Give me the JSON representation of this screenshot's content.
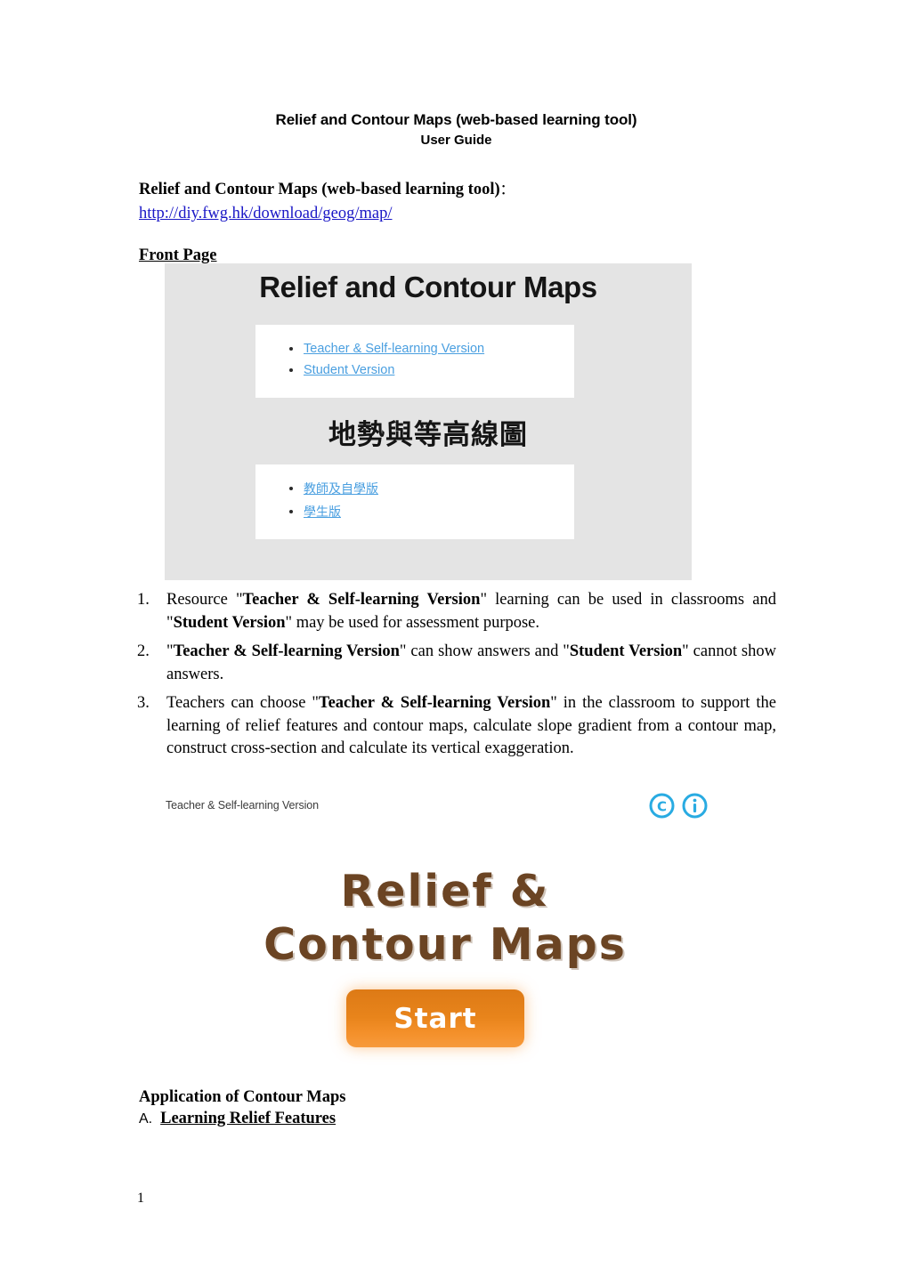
{
  "document": {
    "title": "Relief and Contour Maps (web-based learning tool)",
    "subtitle": "User Guide",
    "intro_label": "Relief and Contour Maps (web-based learning tool)",
    "intro_colon": "：",
    "url": "http://diy.fwg.hk/download/geog/map/",
    "front_page_heading": "Front Page",
    "page_number": "1"
  },
  "front_page_screenshot": {
    "title_en": "Relief and Contour Maps",
    "title_zh": "地勢與等高線圖",
    "links_en": [
      "Teacher & Self-learning Version",
      "Student Version"
    ],
    "links_zh": [
      "教師及自學版",
      "學生版"
    ]
  },
  "notes": [
    {
      "marker": "1.",
      "parts": [
        {
          "text": "Resource \"",
          "bold": false
        },
        {
          "text": "Teacher & Self-learning Version",
          "bold": true
        },
        {
          "text": "\" learning can be used in classrooms and \"",
          "bold": false
        },
        {
          "text": "Student Version",
          "bold": true
        },
        {
          "text": "\" may be used for assessment purpose.",
          "bold": false
        }
      ]
    },
    {
      "marker": "2.",
      "parts": [
        {
          "text": "\"",
          "bold": false
        },
        {
          "text": "Teacher & Self-learning Version",
          "bold": true
        },
        {
          "text": "\" can show answers and \"",
          "bold": false
        },
        {
          "text": "Student Version",
          "bold": true
        },
        {
          "text": "\" cannot show answers.",
          "bold": false
        }
      ]
    },
    {
      "marker": "3.",
      "parts": [
        {
          "text": "Teachers can choose \"",
          "bold": false
        },
        {
          "text": "Teacher & Self-learning Version",
          "bold": true
        },
        {
          "text": "\" in the classroom to support the learning of relief features and contour maps, calculate slope gradient from a contour map, construct cross-section and calculate its vertical exaggeration.",
          "bold": false
        }
      ]
    }
  ],
  "app_screenshot": {
    "version_label": "Teacher & Self-learning Version",
    "logo_line_1": "Relief &",
    "logo_line_2": "Contour Maps",
    "start_button": "Start",
    "icons": [
      "copyright-icon",
      "info-icon"
    ],
    "colors": {
      "logo_brown": "#6b4423",
      "start_orange": "#e8841b",
      "cc_blue": "#29abe2"
    }
  },
  "application_section": {
    "heading": "Application of Contour Maps",
    "item_letter": "A.",
    "item_text": "Learning Relief Features"
  }
}
